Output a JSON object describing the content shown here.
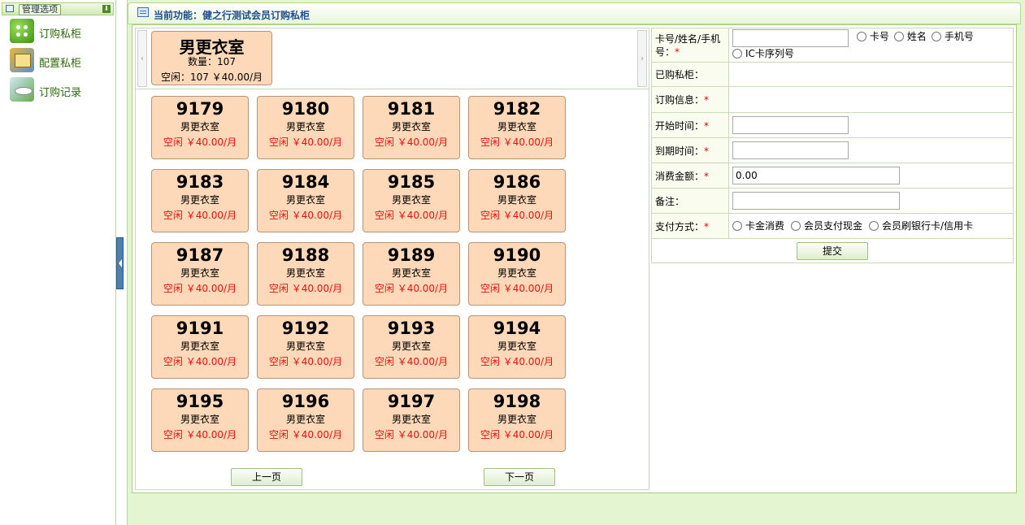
{
  "sidebar": {
    "header_title": "管理选项",
    "items": [
      {
        "label": "订购私柜",
        "icon": "locker-order-icon"
      },
      {
        "label": "配置私柜",
        "icon": "locker-config-icon"
      },
      {
        "label": "订购记录",
        "icon": "order-record-icon"
      }
    ]
  },
  "main": {
    "title": "当前功能：健之行测试会员订购私柜"
  },
  "room": {
    "name": "男更衣室",
    "count": "数量：107",
    "free": "空闲：107  ￥40.00/月"
  },
  "lockers": [
    {
      "num": "9179",
      "room": "男更衣室",
      "price": "空闲 ￥40.00/月"
    },
    {
      "num": "9180",
      "room": "男更衣室",
      "price": "空闲 ￥40.00/月"
    },
    {
      "num": "9181",
      "room": "男更衣室",
      "price": "空闲 ￥40.00/月"
    },
    {
      "num": "9182",
      "room": "男更衣室",
      "price": "空闲 ￥40.00/月"
    },
    {
      "num": "9183",
      "room": "男更衣室",
      "price": "空闲 ￥40.00/月"
    },
    {
      "num": "9184",
      "room": "男更衣室",
      "price": "空闲 ￥40.00/月"
    },
    {
      "num": "9185",
      "room": "男更衣室",
      "price": "空闲 ￥40.00/月"
    },
    {
      "num": "9186",
      "room": "男更衣室",
      "price": "空闲 ￥40.00/月"
    },
    {
      "num": "9187",
      "room": "男更衣室",
      "price": "空闲 ￥40.00/月"
    },
    {
      "num": "9188",
      "room": "男更衣室",
      "price": "空闲 ￥40.00/月"
    },
    {
      "num": "9189",
      "room": "男更衣室",
      "price": "空闲 ￥40.00/月"
    },
    {
      "num": "9190",
      "room": "男更衣室",
      "price": "空闲 ￥40.00/月"
    },
    {
      "num": "9191",
      "room": "男更衣室",
      "price": "空闲 ￥40.00/月"
    },
    {
      "num": "9192",
      "room": "男更衣室",
      "price": "空闲 ￥40.00/月"
    },
    {
      "num": "9193",
      "room": "男更衣室",
      "price": "空闲 ￥40.00/月"
    },
    {
      "num": "9194",
      "room": "男更衣室",
      "price": "空闲 ￥40.00/月"
    },
    {
      "num": "9195",
      "room": "男更衣室",
      "price": "空闲 ￥40.00/月"
    },
    {
      "num": "9196",
      "room": "男更衣室",
      "price": "空闲 ￥40.00/月"
    },
    {
      "num": "9197",
      "room": "男更衣室",
      "price": "空闲 ￥40.00/月"
    },
    {
      "num": "9198",
      "room": "男更衣室",
      "price": "空闲 ￥40.00/月"
    }
  ],
  "pager": {
    "prev": "上一页",
    "next": "下一页"
  },
  "form": {
    "card_label": "卡号/姓名/手机号：",
    "card_value": "",
    "search_options": [
      "卡号",
      "姓名",
      "手机号",
      "IC卡序列号"
    ],
    "purchased_label": "已购私柜：",
    "order_info_label": "订购信息：",
    "start_label": "开始时间：",
    "start_value": "",
    "end_label": "到期时间：",
    "end_value": "",
    "amount_label": "消费金额：",
    "amount_value": "0.00",
    "remark_label": "备注：",
    "remark_value": "",
    "pay_label": "支付方式：",
    "pay_options": [
      "卡金消费",
      "会员支付现金",
      "会员刷银行卡/信用卡"
    ],
    "submit": "提交",
    "required_mark": "*"
  }
}
